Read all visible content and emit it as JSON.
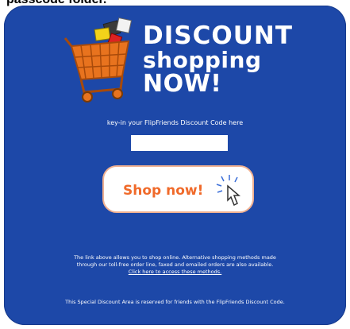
{
  "header": {
    "cut_text": "passcode folder."
  },
  "banner": {
    "line1": "DISCOUNT",
    "line2": "shopping",
    "line3": "NOW!"
  },
  "form": {
    "instruction": "key-in your FlipFriends Discount Code here",
    "code_value": "",
    "code_placeholder": ""
  },
  "button": {
    "label": "Shop now!"
  },
  "footer": {
    "line1": "The link above allows you to shop online. Alternative shopping methods made",
    "line2": "through our toll-free order line, faxed and emailed orders are also available.",
    "link_text": "Click here to access these methods.",
    "note": "This Special Discount Area is reserved for friends with the FlipFriends Discount Code."
  },
  "colors": {
    "panel": "#1d48a8",
    "button_text": "#f06a2a",
    "cart": "#e8731e"
  },
  "icons": [
    "shopping-cart-icon",
    "hand-pointer-cursor-icon"
  ]
}
